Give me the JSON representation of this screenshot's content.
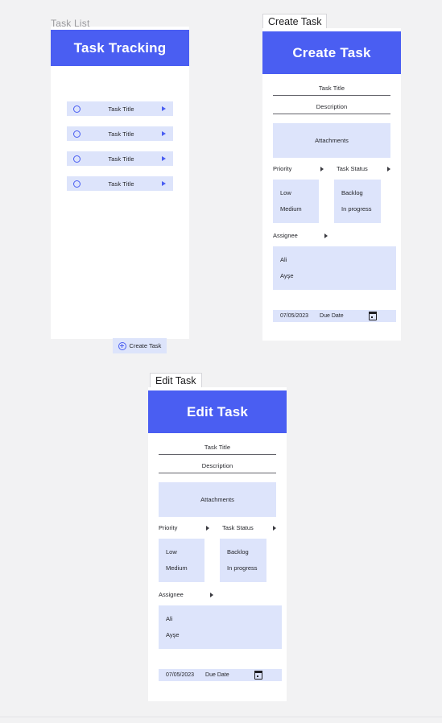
{
  "page": {
    "background_color": "#f2f2f3",
    "accent_color": "#4a5ef2",
    "accent_light_color": "#dde4fb"
  },
  "task_list_frame": {
    "frame_label": "Task List",
    "header_title": "Task Tracking",
    "rows": [
      {
        "label": "Task Title"
      },
      {
        "label": "Task Title"
      },
      {
        "label": "Task Title"
      },
      {
        "label": "Task Title"
      }
    ],
    "create_button": {
      "label": "Create Task",
      "icon": "plus-circle-icon"
    }
  },
  "create_task_frame": {
    "frame_label": "Create Task",
    "header_title": "Create Task",
    "fields": {
      "title_label": "Task Title",
      "description_label": "Description",
      "attachments_label": "Attachments"
    },
    "priority": {
      "label": "Priority",
      "options": [
        "Low",
        "Medium"
      ]
    },
    "task_status": {
      "label": "Task Status",
      "options": [
        "Backlog",
        "In progress"
      ]
    },
    "assignee": {
      "label": "Assignee",
      "options": [
        "Ali",
        "Ayşe"
      ]
    },
    "due_date": {
      "value": "07/05/2023",
      "label": "Due Date",
      "icon": "calendar-icon"
    }
  },
  "edit_task_frame": {
    "frame_label": "Edit Task",
    "header_title": "Edit Task",
    "fields": {
      "title_label": "Task Title",
      "description_label": "Description",
      "attachments_label": "Attachments"
    },
    "priority": {
      "label": "Priority",
      "options": [
        "Low",
        "Medium"
      ]
    },
    "task_status": {
      "label": "Task Status",
      "options": [
        "Backlog",
        "In progress"
      ]
    },
    "assignee": {
      "label": "Assignee",
      "options": [
        "Ali",
        "Ayşe"
      ]
    },
    "due_date": {
      "value": "07/05/2023",
      "label": "Due Date",
      "icon": "calendar-icon"
    }
  }
}
